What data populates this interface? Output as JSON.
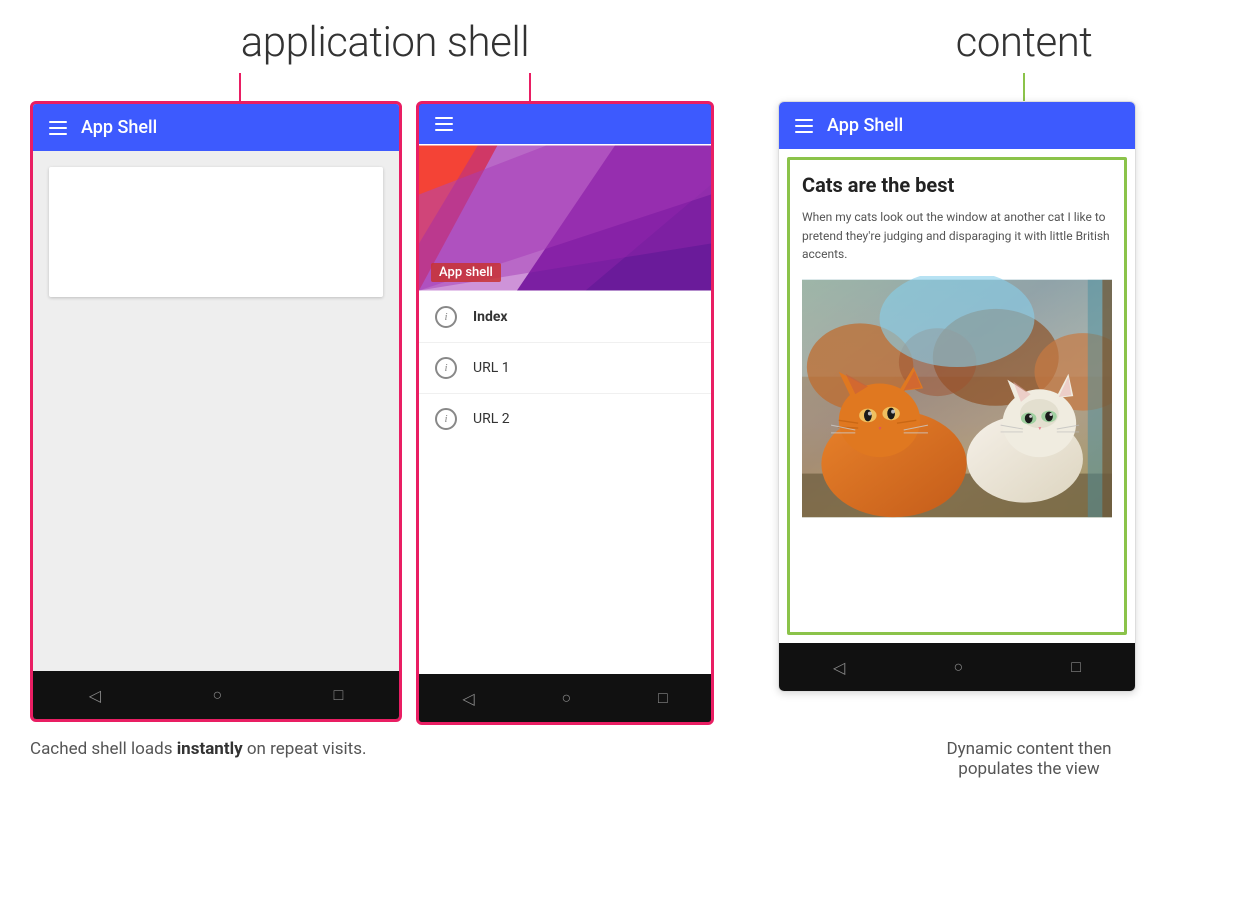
{
  "page": {
    "background": "#ffffff"
  },
  "top_labels": {
    "app_shell": "application shell",
    "content": "content"
  },
  "left_phone": {
    "app_bar_title": "App Shell",
    "show_placeholder": true
  },
  "middle_phone": {
    "drawer_label": "App shell",
    "nav_items": [
      {
        "label": "Index",
        "bold": true
      },
      {
        "label": "URL 1",
        "bold": false
      },
      {
        "label": "URL 2",
        "bold": false
      }
    ]
  },
  "right_phone": {
    "app_bar_title": "App Shell",
    "content_title": "Cats are the best",
    "content_text": "When my cats look out the window at another cat I like to pretend they're judging and disparaging it with little British accents."
  },
  "bottom_captions": {
    "left": "Cached shell loads ",
    "left_bold": "instantly",
    "left_end": " on repeat visits.",
    "right_line1": "Dynamic content then",
    "right_line2": "populates the view"
  },
  "nav_icons": {
    "back": "◁",
    "home": "○",
    "recent": "□"
  }
}
